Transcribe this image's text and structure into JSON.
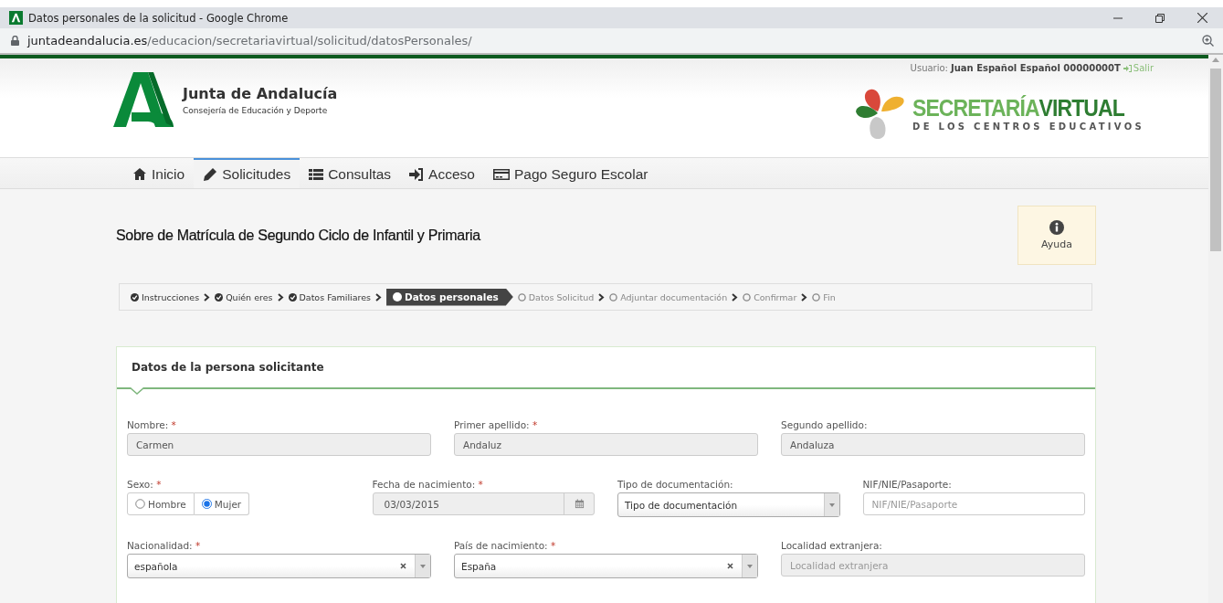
{
  "window": {
    "title": "Datos personales de la solicitud - Google Chrome"
  },
  "address_bar": {
    "domain": "juntadeandalucia.es",
    "path": "/educacion/secretariavirtual/solicitud/datosPersonales/"
  },
  "header": {
    "org_name": "Junta de Andalucía",
    "org_sub": "Consejería de Educación y Deporte",
    "user_label": "Usuario:",
    "user_name": "Juan Español Español 00000000T",
    "logout": "Salir",
    "brand_light": "SECRETARÍA",
    "brand_dark": "VIRTUAL",
    "brand_sub": "DE LOS CENTROS EDUCATIVOS"
  },
  "nav": [
    {
      "label": "Inicio",
      "selected": false
    },
    {
      "label": "Solicitudes",
      "selected": true
    },
    {
      "label": "Consultas",
      "selected": false
    },
    {
      "label": "Acceso",
      "selected": false
    },
    {
      "label": "Pago Seguro Escolar",
      "selected": false
    }
  ],
  "page_title": "Sobre de Matrícula de Segundo Ciclo de Infantil y Primaria",
  "help_button": "Ayuda",
  "steps": [
    {
      "label": "Instrucciones",
      "done": true,
      "selected": false
    },
    {
      "label": "Quién eres",
      "done": true,
      "selected": false
    },
    {
      "label": "Datos Familiares",
      "done": true,
      "selected": false
    },
    {
      "label": "Datos personales",
      "selected": true
    },
    {
      "label": "Datos Solicitud",
      "done": false,
      "selected": false
    },
    {
      "label": "Adjuntar documentación",
      "done": false,
      "selected": false
    },
    {
      "label": "Confirmar",
      "done": false,
      "selected": false
    },
    {
      "label": "Fin",
      "done": false,
      "selected": false
    }
  ],
  "panel": {
    "title": "Datos de la persona solicitante",
    "rows": [
      [
        {
          "kind": "text",
          "label": "Nombre:",
          "mark": "*",
          "value": "Carmen",
          "disabled": true
        },
        {
          "kind": "text",
          "label": "Primer apellido:",
          "mark": "*",
          "value": "Andaluz",
          "disabled": true
        },
        {
          "kind": "text",
          "label": "Segundo apellido:",
          "value": "Andaluza",
          "disabled": true
        }
      ],
      [
        {
          "kind": "radio",
          "label": "Sexo:",
          "mark": "*",
          "options": [
            {
              "label": "Hombre",
              "selected": false
            },
            {
              "label": "Mujer",
              "selected": true
            }
          ]
        },
        {
          "kind": "date",
          "label": "Fecha de nacimiento:",
          "mark": "*",
          "value": "03/03/2015",
          "disabled": true
        },
        {
          "kind": "select",
          "label": "Tipo de documentación:",
          "value": "Tipo de documentación",
          "clearable": false
        },
        {
          "kind": "text",
          "label": "NIF/NIE/Pasaporte:",
          "placeholder": "NIF/NIE/Pasaporte",
          "disabled": false
        }
      ],
      [
        {
          "kind": "select",
          "label": "Nacionalidad:",
          "mark": "*",
          "value": "española",
          "clearable": true
        },
        {
          "kind": "select",
          "label": "País de nacimiento:",
          "mark": "*",
          "value": "España",
          "clearable": true
        },
        {
          "kind": "text",
          "label": "Localidad extranjera:",
          "placeholder": "Localidad extranjera",
          "disabled": true
        }
      ]
    ]
  }
}
